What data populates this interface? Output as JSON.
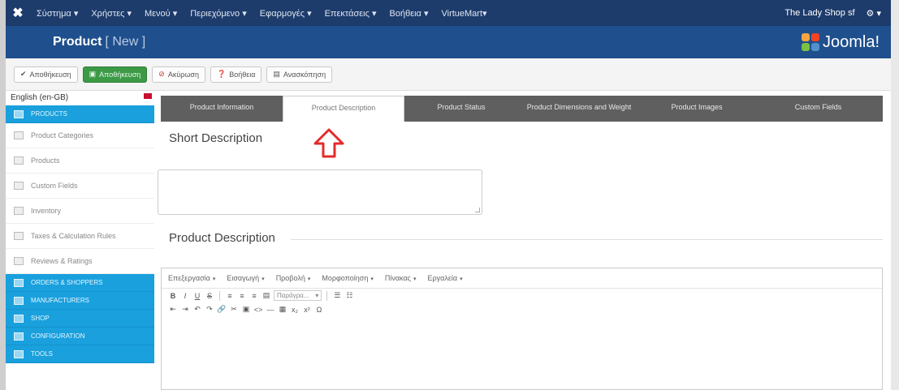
{
  "menubar": {
    "items": [
      "Σύστημα ▾",
      "Χρήστες ▾",
      "Μενού ▾",
      "Περιεχόμενο ▾",
      "Εφαρμογές ▾",
      "Επεκτάσεις ▾",
      "Βοήθεια ▾",
      "VirtueMart▾"
    ],
    "site_name": "The Lady Shop sf",
    "settings_icon": "gear-icon"
  },
  "titlebar": {
    "title": "Product",
    "subtitle": "[ New ]",
    "brand": "Joomla!"
  },
  "toolbar": {
    "buttons": [
      {
        "label": "Αποθήκευση",
        "icon": "check-icon"
      },
      {
        "label": "Αποθήκευση",
        "icon": "save-icon"
      },
      {
        "label": "Ακύρωση",
        "icon": "cancel-icon"
      },
      {
        "label": "Βοήθεια",
        "icon": "help-icon"
      },
      {
        "label": "Ανασκόπηση",
        "icon": "preview-icon"
      }
    ]
  },
  "sidebar": {
    "language": "English (en-GB)",
    "items": [
      {
        "label": "PRODUCTS",
        "header": true
      },
      {
        "label": "Product Categories",
        "header": false
      },
      {
        "label": "Products",
        "header": false
      },
      {
        "label": "Custom Fields",
        "header": false
      },
      {
        "label": "Inventory",
        "header": false
      },
      {
        "label": "Taxes & Calculation Rules",
        "header": false
      },
      {
        "label": "Reviews & Ratings",
        "header": false
      },
      {
        "label": "ORDERS & SHOPPERS",
        "header": true
      },
      {
        "label": "MANUFACTURERS",
        "header": true
      },
      {
        "label": "SHOP",
        "header": true
      },
      {
        "label": "CONFIGURATION",
        "header": true
      },
      {
        "label": "TOOLS",
        "header": true
      }
    ]
  },
  "tabs": [
    {
      "label": "Product Information",
      "active": false
    },
    {
      "label": "Product Description",
      "active": true
    },
    {
      "label": "Product Status",
      "active": false
    },
    {
      "label": "Product Dimensions and Weight",
      "active": false
    },
    {
      "label": "Product Images",
      "active": false
    },
    {
      "label": "Custom Fields",
      "active": false
    }
  ],
  "sections": {
    "short_description": "Short Description",
    "product_description": "Product Description"
  },
  "editor": {
    "menus": [
      "Επεξεργασία",
      "Εισαγωγή",
      "Προβολή",
      "Μορφοποίηση",
      "Πίνακας",
      "Εργαλεία"
    ],
    "row1": [
      "B",
      "I",
      "U",
      "S"
    ],
    "format_select": "Παράγρα...",
    "row2": [
      "⇤",
      "⇥",
      "↶",
      "↷",
      "🔗",
      "✂",
      "▣",
      "<>",
      "—",
      "▦",
      "x₂",
      "x²",
      "Ω"
    ]
  },
  "colors": {
    "menubar": "#1d3b6b",
    "titlebar": "#1f4f8c",
    "accent": "#19a0dd",
    "tabs_bg": "#5f5f5f",
    "arrow": "#e32b2b"
  }
}
